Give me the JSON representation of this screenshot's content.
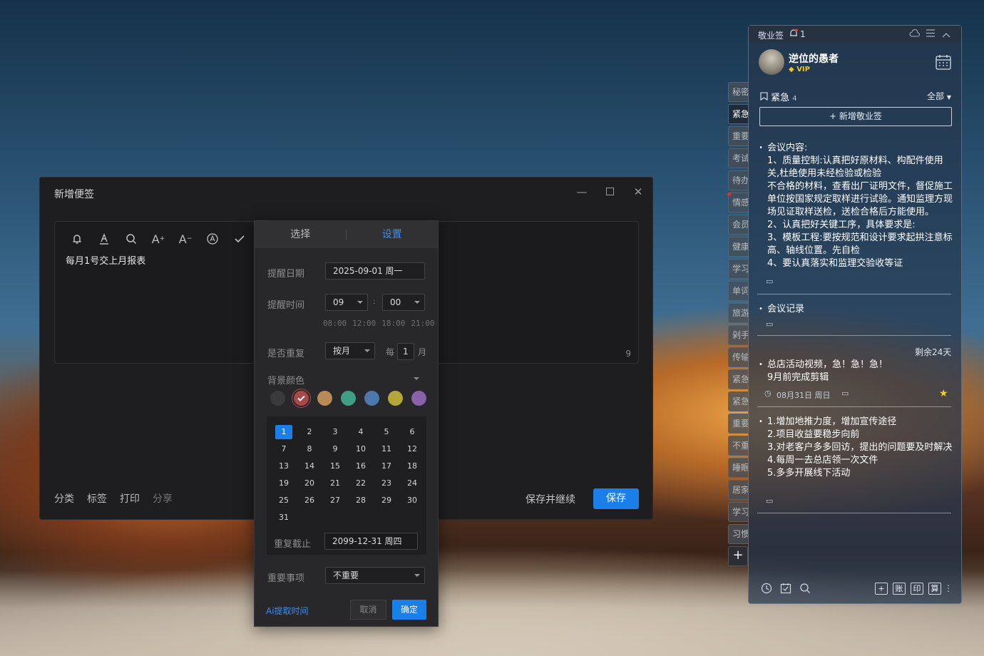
{
  "main_window": {
    "title": "新增便签",
    "note_text": "每月1号交上月报表",
    "char_count": "9",
    "footer": [
      "分类",
      "标签",
      "打印",
      "分享"
    ],
    "save_continue": "保存并继续",
    "save": "保存"
  },
  "reminder_popup": {
    "tabs": [
      "选择",
      "设置"
    ],
    "active_tab": "设置",
    "date_label": "提醒日期",
    "date_value": "2025-09-01 周一",
    "time_label": "提醒时间",
    "hour": "09",
    "colon": ":",
    "minute": "00",
    "quick_times": [
      "08:00",
      "12:00",
      "18:00",
      "21:00"
    ],
    "repeat_label": "是否重复",
    "repeat_value": "按月",
    "every_prefix": "每",
    "every_value": "1",
    "every_suffix": "月",
    "bg_color_label": "背景颜色",
    "colors": [
      "#3a3a3c",
      "#a84848",
      "#b98a55",
      "#3e9e86",
      "#4c78ad",
      "#b3a63a",
      "#8a62a8"
    ],
    "selected_color": "#a84848",
    "days": [
      "1",
      "2",
      "3",
      "4",
      "5",
      "6",
      "7",
      "8",
      "9",
      "10",
      "11",
      "12",
      "13",
      "14",
      "15",
      "16",
      "17",
      "18",
      "19",
      "20",
      "21",
      "22",
      "23",
      "24",
      "25",
      "26",
      "27",
      "28",
      "29",
      "30",
      "31"
    ],
    "selected_day": "1",
    "repeat_until_label": "重复截止",
    "repeat_until_value": "2099-12-31 周四",
    "importance_label": "重要事项",
    "importance_value": "不重要",
    "ai_link": "Ai提取时间",
    "cancel": "取消",
    "confirm": "确定"
  },
  "side_tabs": [
    "秘密",
    "紧急",
    "重要",
    "考试",
    "待办",
    "情感",
    "会员",
    "健康",
    "学习",
    "单词",
    "旅游",
    "剁手",
    "传输",
    "紧急",
    "紧急",
    "重要",
    "不重",
    "睡眠",
    "居家",
    "学习",
    "习惯"
  ],
  "side_active": "紧急",
  "panel": {
    "app_name": "敬业签",
    "notify_count": "1",
    "username": "逆位的愚者",
    "vip": "VIP",
    "category": "紧急",
    "category_count": "4",
    "filter": "全部",
    "add_note": "+ 新增敬业签",
    "items": [
      {
        "text": "会议内容:\n1、质量控制:认真把好原材料、构配件使用关,杜绝使用未经检验或检验\n不合格的材料，查看出厂证明文件，督促施工单位按国家规定取样进行试验。通知监理方现场见证取样送检，送检合格后方能使用。\n2、认真把好关键工序，具体要求是:\n3、模板工程:要按规范和设计要求起拱注意标高、轴线位置。先自检\n4、要认真落实和监理交验收等证"
      },
      {
        "text": "会议记录"
      },
      {
        "remaining": "剩余24天",
        "text": "总店活动视频，急！急！急！\n9月前完成剪辑",
        "date": "08月31日 周日"
      },
      {
        "text": "1.增加地推力度，增加宣传途径\n2.项目收益要稳步向前\n3.对老客户多多回访，提出的问题要及时解决\n4.每周一去总店领一次文件\n5.多多开展线下活动"
      }
    ],
    "footer_buttons": [
      "+",
      "账",
      "印",
      "算"
    ]
  }
}
